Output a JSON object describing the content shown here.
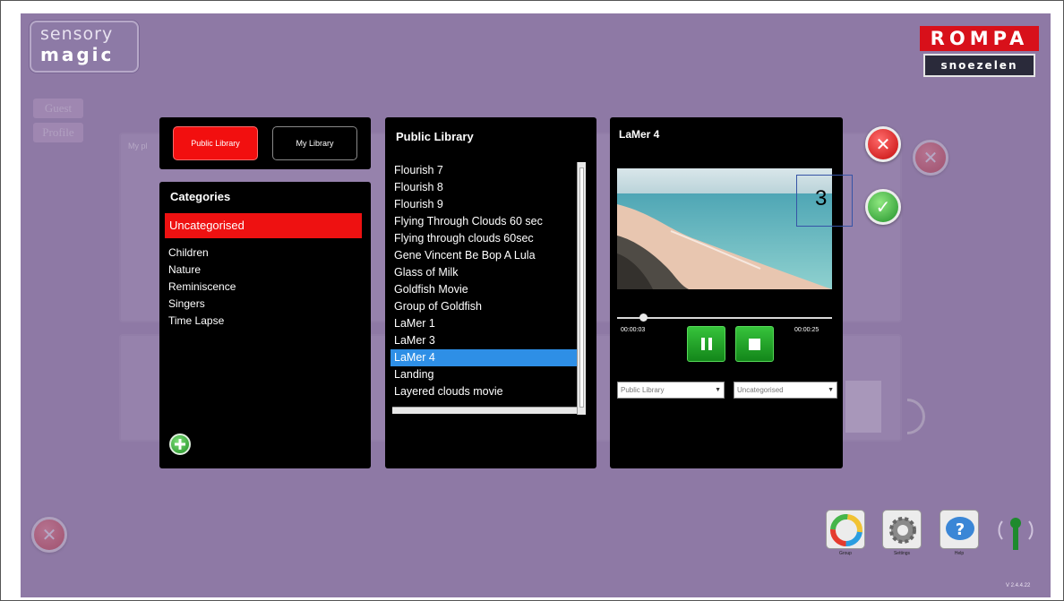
{
  "branding": {
    "sensory_line1": "sensory",
    "sensory_line2": "magic",
    "rompa_top": "ROMPA",
    "rompa_bottom": "snoezelen"
  },
  "background": {
    "left_buttons": [
      "Guest",
      "Profile"
    ],
    "playlist_label": "My pl"
  },
  "library_tabs": {
    "public_label": "Public Library",
    "my_label": "My Library",
    "active": "Public Library"
  },
  "categories": {
    "title": "Categories",
    "selected": "Uncategorised",
    "items": [
      "Children",
      "Nature",
      "Reminiscence",
      "Singers",
      "Time Lapse"
    ]
  },
  "media_list": {
    "title": "Public Library",
    "items": [
      "Flourish 7",
      "Flourish 8",
      "Flourish 9",
      "Flying Through Clouds 60 sec",
      "Flying through clouds 60sec",
      "Gene Vincent Be Bop A Lula",
      "Glass of Milk",
      "Goldfish Movie",
      "Group of Goldfish",
      "LaMer 1",
      "LaMer 3",
      "LaMer 4",
      "Landing",
      "Layered clouds movie"
    ],
    "selected": "LaMer 4"
  },
  "preview": {
    "title": "LaMer 4",
    "time_current": "00:00:03",
    "time_total": "00:00:25",
    "progress": 0.12,
    "library_dropdown": "Public Library",
    "category_dropdown": "Uncategorised"
  },
  "annotation": {
    "label": "3"
  },
  "toolbar": {
    "captions": [
      "Group",
      "Settings",
      "Help"
    ],
    "version": "V 2.4.4.22"
  },
  "colors": {
    "app_background": "#8e79a5",
    "accent_red": "#ee1111",
    "accent_green": "#21922a",
    "selection_blue": "#2e8fe6"
  }
}
